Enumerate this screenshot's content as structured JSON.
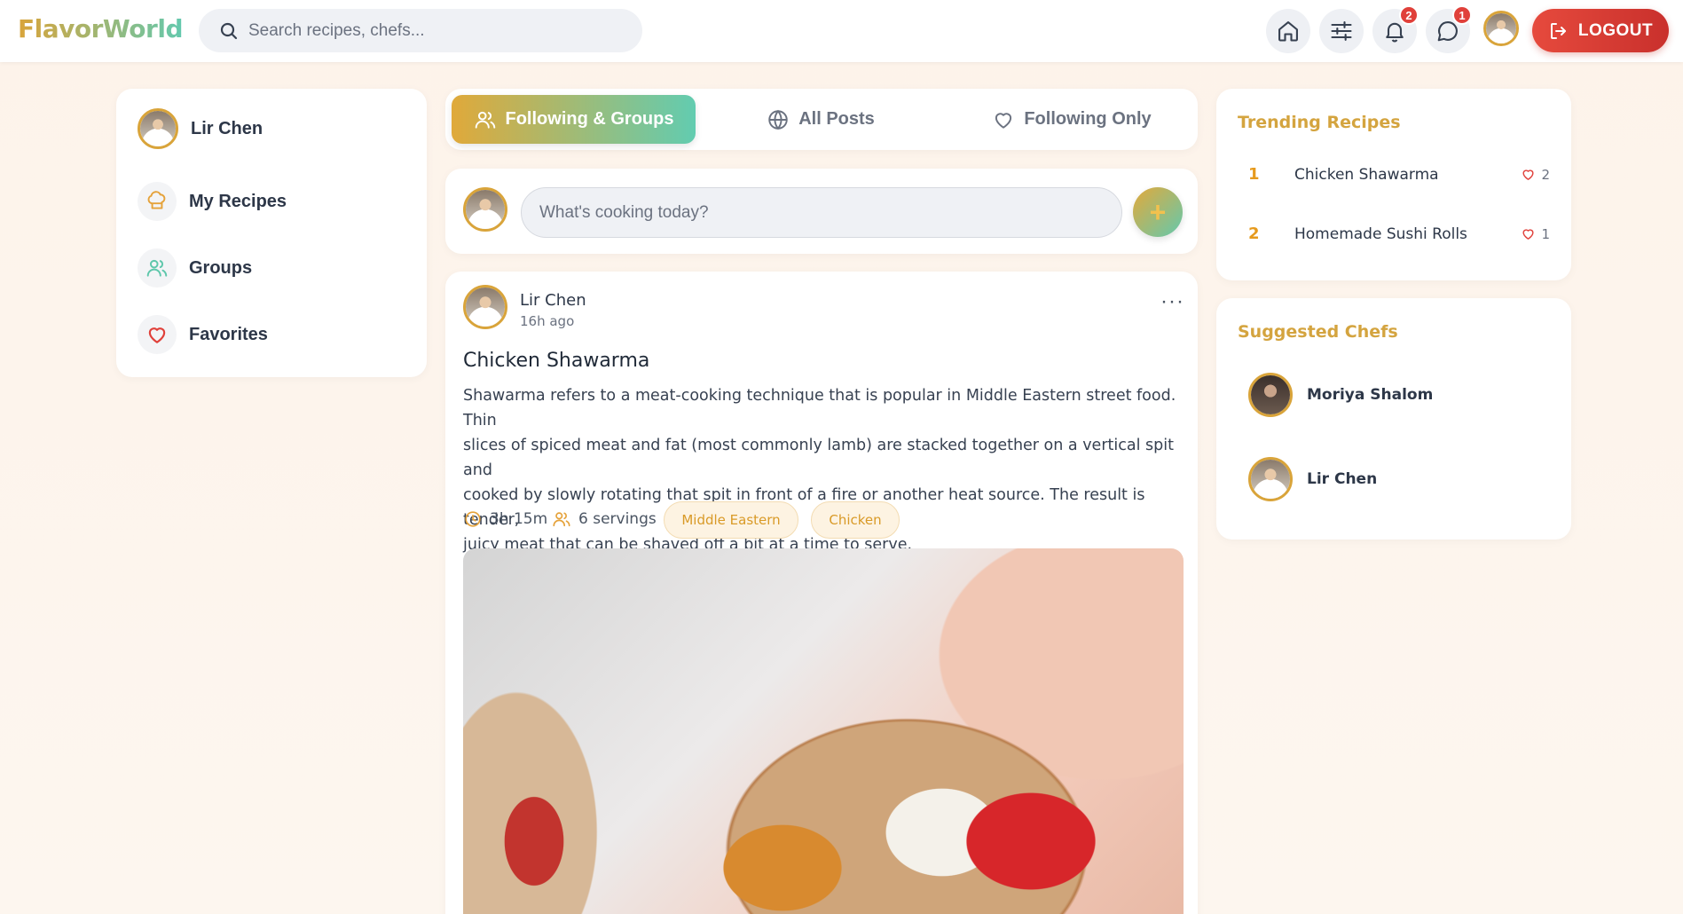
{
  "app": {
    "logo": "FlavorWorld"
  },
  "header": {
    "search_placeholder": "Search recipes, chefs...",
    "notifications_count": "2",
    "messages_count": "1",
    "logout_label": "LOGOUT"
  },
  "sidebar": {
    "user_name": "Lir Chen",
    "items": [
      {
        "label": "My Recipes",
        "icon": "chef-hat-icon"
      },
      {
        "label": "Groups",
        "icon": "users-icon"
      },
      {
        "label": "Favorites",
        "icon": "heart-icon"
      }
    ]
  },
  "tabs": [
    {
      "label": "Following & Groups",
      "active": true
    },
    {
      "label": "All Posts",
      "active": false
    },
    {
      "label": "Following Only",
      "active": false
    }
  ],
  "composer": {
    "placeholder": "What's cooking today?"
  },
  "post": {
    "author": "Lir Chen",
    "time": "16h ago",
    "title": "Chicken Shawarma",
    "body_lines": [
      "Shawarma refers to a meat-cooking technique that is popular in Middle Eastern street food. Thin",
      "slices of spiced meat and fat (most commonly lamb) are stacked together on a vertical spit and",
      "cooked by slowly rotating that spit in front of a fire or another heat source. The result is tender,",
      "juicy meat that can be shaved off a bit at a time to serve."
    ],
    "prep_time": "3h 15m",
    "servings": "6 servings",
    "tags": [
      "Middle Eastern",
      "Chicken"
    ]
  },
  "trending": {
    "title": "Trending Recipes",
    "items": [
      {
        "rank": "1",
        "name": "Chicken Shawarma",
        "likes": "2"
      },
      {
        "rank": "2",
        "name": "Homemade Sushi Rolls",
        "likes": "1"
      }
    ]
  },
  "suggested": {
    "title": "Suggested Chefs",
    "chefs": [
      {
        "name": "Moriya Shalom"
      },
      {
        "name": "Lir Chen"
      }
    ]
  },
  "colors": {
    "accent_gold": "#d9a43a",
    "accent_teal": "#63c9ae",
    "logout_red": "#e64a3d",
    "badge_red": "#e0403a"
  }
}
